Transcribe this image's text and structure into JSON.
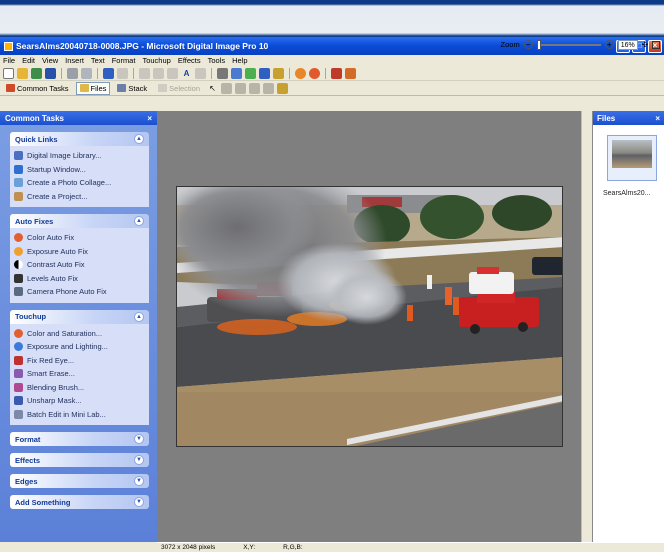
{
  "window": {
    "title": "SearsAlms20040718-0008.JPG - Microsoft Digital Image Pro 10",
    "controls": [
      "_",
      "□",
      "×"
    ]
  },
  "menu": [
    "File",
    "Edit",
    "View",
    "Insert",
    "Text",
    "Format",
    "Touchup",
    "Effects",
    "Tools",
    "Help"
  ],
  "toolbar2": {
    "common_tasks": "Common Tasks",
    "files": "Files",
    "stack": "Stack",
    "selection": "Selection",
    "zoom_label": "Zoom",
    "zoom_value": "16%"
  },
  "taskpane": {
    "title": "Common Tasks",
    "close": "×",
    "groups": [
      {
        "title": "Quick Links",
        "expanded": true,
        "items": [
          "Digital Image Library...",
          "Startup Window...",
          "Create a Photo Collage...",
          "Create a Project..."
        ]
      },
      {
        "title": "Auto Fixes",
        "expanded": true,
        "items": [
          "Color Auto Fix",
          "Exposure Auto Fix",
          "Contrast Auto Fix",
          "Levels Auto Fix",
          "Camera Phone Auto Fix"
        ]
      },
      {
        "title": "Touchup",
        "expanded": true,
        "items": [
          "Color and Saturation...",
          "Exposure and Lighting...",
          "Fix Red Eye...",
          "Smart Erase...",
          "Blending Brush...",
          "Unsharp Mask...",
          "Batch Edit in Mini Lab..."
        ]
      },
      {
        "title": "Format",
        "expanded": false,
        "items": []
      },
      {
        "title": "Effects",
        "expanded": false,
        "items": []
      },
      {
        "title": "Edges",
        "expanded": false,
        "items": []
      },
      {
        "title": "Add Something",
        "expanded": false,
        "items": []
      }
    ]
  },
  "files_panel": {
    "title": "Files",
    "close": "×",
    "thumb_label": "SearsAlms20..."
  },
  "status": {
    "dimensions": "3072 x 2048 pixels",
    "xy": "X,Y:",
    "rgb": "R,G,B:"
  },
  "colors": {
    "title_blue": "#0a4bd6",
    "pane_blue": "#6f93df",
    "canvas_gray": "#807f80"
  }
}
